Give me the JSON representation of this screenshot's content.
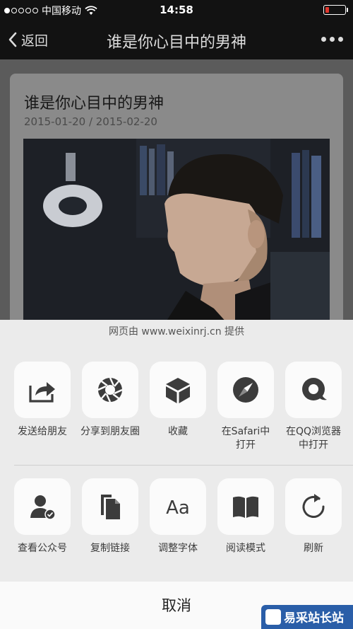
{
  "status_bar": {
    "carrier": "中国移动",
    "time": "14:58"
  },
  "nav_bar": {
    "back_label": "返回",
    "title": "谁是你心目中的男神"
  },
  "article": {
    "title": "谁是你心目中的男神",
    "date_range": "2015-01-20 / 2015-02-20"
  },
  "share_sheet": {
    "provider": "网页由 www.weixinrj.cn 提供",
    "row1": [
      {
        "label": "发送给朋友",
        "icon": "send-to-friend-icon"
      },
      {
        "label": "分享到朋友圈",
        "icon": "moments-icon"
      },
      {
        "label": "收藏",
        "icon": "favorite-cube-icon"
      },
      {
        "label": "在Safari中\n打开",
        "icon": "safari-compass-icon"
      },
      {
        "label": "在QQ浏览器\n中打开",
        "icon": "qq-browser-icon"
      }
    ],
    "row2": [
      {
        "label": "查看公众号",
        "icon": "official-account-icon"
      },
      {
        "label": "复制链接",
        "icon": "copy-link-icon"
      },
      {
        "label": "调整字体",
        "icon": "font-size-icon"
      },
      {
        "label": "阅读模式",
        "icon": "reading-mode-icon"
      },
      {
        "label": "刷新",
        "icon": "refresh-icon"
      }
    ],
    "cancel_label": "取消",
    "font_icon_text": "Aa"
  },
  "watermark": {
    "text": "易采站长站"
  },
  "colors": {
    "bar": "#121212",
    "sheet": "#ebebeb",
    "tile": "#fbfbfb",
    "battery": "#e2372d"
  }
}
